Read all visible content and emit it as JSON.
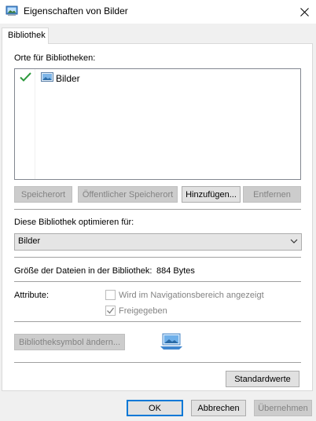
{
  "window": {
    "title": "Eigenschaften von Bilder"
  },
  "tabs": [
    {
      "label": "Bibliothek"
    }
  ],
  "locations": {
    "label": "Orte für Bibliotheken:",
    "items": [
      {
        "name": "Bilder",
        "checked": true
      }
    ]
  },
  "location_buttons": {
    "save_location": "Speicherort",
    "public_save_location": "Öffentlicher Speicherort",
    "add": "Hinzufügen...",
    "remove": "Entfernen"
  },
  "optimize": {
    "label": "Diese Bibliothek optimieren für:",
    "selected": "Bilder"
  },
  "size": {
    "label": "Größe der Dateien in der Bibliothek:",
    "value": "884 Bytes"
  },
  "attributes": {
    "label": "Attribute:",
    "nav_shown": {
      "label": "Wird im Navigationsbereich angezeigt",
      "checked": false
    },
    "shared": {
      "label": "Freigegeben",
      "checked": true
    }
  },
  "change_icon_button": "Bibliotheksymbol ändern...",
  "defaults_button": "Standardwerte",
  "dialog_buttons": {
    "ok": "OK",
    "cancel": "Abbrechen",
    "apply": "Übernehmen"
  },
  "colors": {
    "accent": "#0078d7",
    "check_green": "#2e9a3e"
  }
}
